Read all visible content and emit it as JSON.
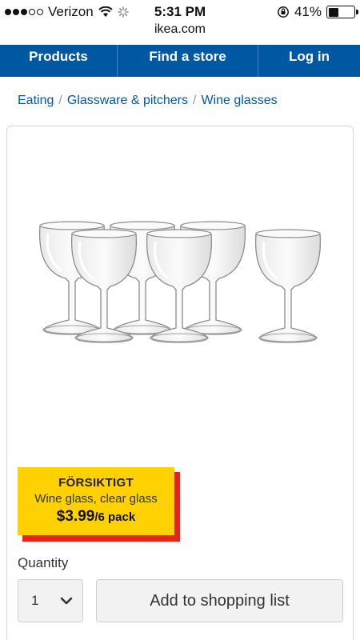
{
  "status_bar": {
    "carrier": "Verizon",
    "time": "5:31 PM",
    "battery": "41%",
    "battery_level": 0.41
  },
  "url": "ikea.com",
  "nav": {
    "items": [
      {
        "label": "Products"
      },
      {
        "label": "Find a store"
      },
      {
        "label": "Log in"
      }
    ]
  },
  "breadcrumb": {
    "items": [
      "Eating",
      "Glassware & pitchers",
      "Wine glasses"
    ],
    "separator": "/"
  },
  "product": {
    "name": "FÖRSIKTIGT",
    "description": "Wine glass, clear glass",
    "price": "$3.99",
    "unit": "/6 pack"
  },
  "quantity": {
    "label": "Quantity",
    "value": "1"
  },
  "actions": {
    "add_to_list": "Add to shopping list"
  },
  "colors": {
    "nav": "#0058a3",
    "tag": "#ffd100",
    "tag_shadow": "#e5241b",
    "link": "#0058a3"
  }
}
